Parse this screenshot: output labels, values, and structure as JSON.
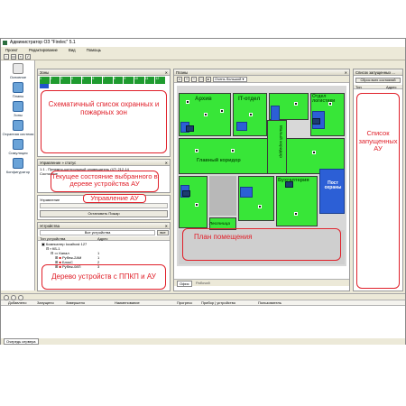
{
  "window": {
    "title": "Администратор ОЗ \"Firelec\" 5.1"
  },
  "menu": [
    "Проект",
    "Редактирование",
    "Вид",
    "Помощь"
  ],
  "sidebar": {
    "items": [
      {
        "label": "Основное",
        "icon": "home-icon"
      },
      {
        "label": "Планы",
        "icon": "plans-icon"
      },
      {
        "label": "Зоны",
        "icon": "zones-icon"
      },
      {
        "label": "Охранная система",
        "icon": "security-icon"
      },
      {
        "label": "Симуляция",
        "icon": "simulation-icon"
      },
      {
        "label": "Конфигуратор",
        "icon": "configurator-icon"
      }
    ]
  },
  "zones_panel": {
    "title": "Зоны",
    "numbers": [
      "1",
      "2",
      "3",
      "4",
      "5",
      "6",
      "7",
      "8",
      "9",
      "10",
      "11",
      "12"
    ],
    "annotation": "Схематичный список охранных и пожарных зон"
  },
  "state_panel": {
    "title": "Управление » статус",
    "line1": "1.1 - Приемно-контрольный оповещатель (47) 212-14",
    "line2": "Состояние",
    "annotation": "Текущее состояние выбранного в дереве устройства АУ"
  },
  "control_panel": {
    "title": "Управление",
    "button": "Остановить Пожар",
    "annotation": "Управление АУ"
  },
  "devices_panel": {
    "title": "Устройства",
    "filter": "Все устройства",
    "filter_btn": "все",
    "columns": {
      "type": "Тип устройства",
      "address": "Адрес"
    },
    "rows": [
      {
        "name": "Компьютер localhost 127",
        "address": ""
      },
      {
        "name": "КБ-1",
        "address": ""
      },
      {
        "name": "Канал",
        "address": "1"
      },
      {
        "name": "Рубеж-2АМ",
        "address": "1"
      },
      {
        "name": "БлокС",
        "address": "2"
      },
      {
        "name": "Рубеж-08П",
        "address": "3"
      }
    ],
    "annotation": "Дерево устройств с ППКП и АУ"
  },
  "plan_panel": {
    "title": "Планы",
    "zoom_label": "Очень большой",
    "tab1": "Офис",
    "tab2": "Рабочий",
    "rooms": {
      "archive": "Архив",
      "it": "IT-отдел",
      "logistics": "Отдел логистики",
      "main_corridor": "Главный коридор",
      "small_corridor": "Малый коридор",
      "accounting": "Бухгалтерия",
      "guard_post": "Пост охраны",
      "stairs": "Лестница"
    },
    "annotation": "План помещения"
  },
  "running_panel": {
    "title": "Список запущенных ...",
    "button": "Сброс всех состояний",
    "col_type": "Тип",
    "col_addr": "Адрес",
    "annotation": "Список запущенных АУ"
  },
  "log_panel": {
    "columns": [
      "Добавлено",
      "Запущено",
      "Завершено",
      "Наименование",
      "Прогресс",
      "Прибор | устройство",
      "Пользователь"
    ]
  },
  "status": {
    "text": "Очередь сервера"
  },
  "colors": {
    "plan_green": "#2cdc2c",
    "annotation_red": "#e0202a",
    "room_blue": "#2c5fd6"
  }
}
